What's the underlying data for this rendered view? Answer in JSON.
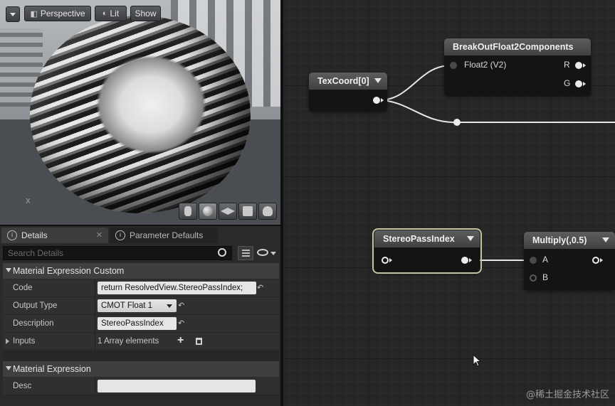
{
  "viewport": {
    "toolbar": {
      "perspective_label": "Perspective",
      "lit_label": "Lit",
      "show_label": "Show"
    },
    "axis_label": "X",
    "preview_shapes": [
      "cylinder-icon",
      "sphere-icon",
      "plane-icon",
      "cube-icon",
      "teapot-icon"
    ]
  },
  "details": {
    "tabs": [
      {
        "label": "Details",
        "active": true
      },
      {
        "label": "Parameter Defaults",
        "active": false
      }
    ],
    "search_placeholder": "Search Details",
    "sections": {
      "custom": {
        "title": "Material Expression Custom",
        "code_label": "Code",
        "code_value": "return ResolvedView.StereoPassIndex;",
        "output_type_label": "Output Type",
        "output_type_value": "CMOT Float 1",
        "description_label": "Description",
        "description_value": "StereoPassIndex",
        "inputs_label": "Inputs",
        "inputs_value": "1 Array elements"
      },
      "expression": {
        "title": "Material Expression",
        "desc_label": "Desc",
        "desc_value": ""
      }
    }
  },
  "graph": {
    "nodes": {
      "texcoord": {
        "title": "TexCoord[0]"
      },
      "breakout": {
        "title": "BreakOutFloat2Components",
        "input_label": "Float2 (V2)",
        "output_r": "R",
        "output_g": "G"
      },
      "stereo": {
        "title": "StereoPassIndex"
      },
      "multiply": {
        "title": "Multiply(,0.5)",
        "input_a": "A",
        "input_b": "B"
      }
    }
  },
  "watermark": "@稀土掘金技术社区",
  "colors": {
    "graph_bg": "#262626",
    "node_body": "#141414",
    "wire": "#e6e6e6",
    "selection_outline": "#c9c2a0"
  }
}
